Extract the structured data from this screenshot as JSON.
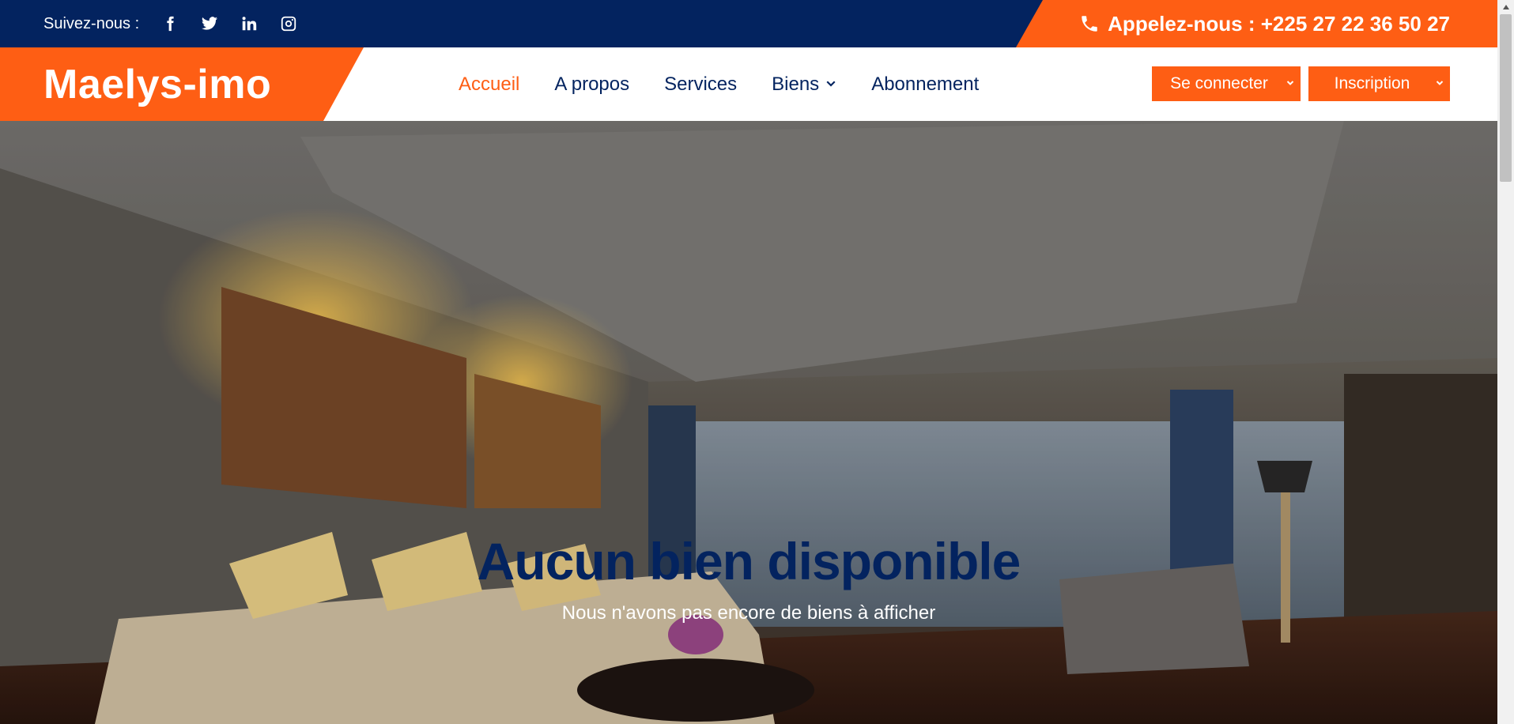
{
  "topbar": {
    "follow_label": "Suivez-nous :",
    "social": [
      "facebook-icon",
      "twitter-icon",
      "linkedin-icon",
      "instagram-icon"
    ],
    "call_text": "Appelez-nous : +225 27 22 36 50 27"
  },
  "navbar": {
    "logo": "Maelys-imo",
    "menu": [
      {
        "label": "Accueil",
        "active": true
      },
      {
        "label": "A propos",
        "active": false
      },
      {
        "label": "Services",
        "active": false
      },
      {
        "label": "Biens",
        "active": false,
        "dropdown": true
      },
      {
        "label": "Abonnement",
        "active": false
      }
    ],
    "login_button": "Se connecter",
    "signup_button": "Inscription"
  },
  "hero": {
    "title": "Aucun bien disponible",
    "subtitle": "Nous n'avons pas encore de biens à afficher"
  },
  "colors": {
    "primary_navy": "#03235f",
    "accent_orange": "#fe5e14"
  }
}
